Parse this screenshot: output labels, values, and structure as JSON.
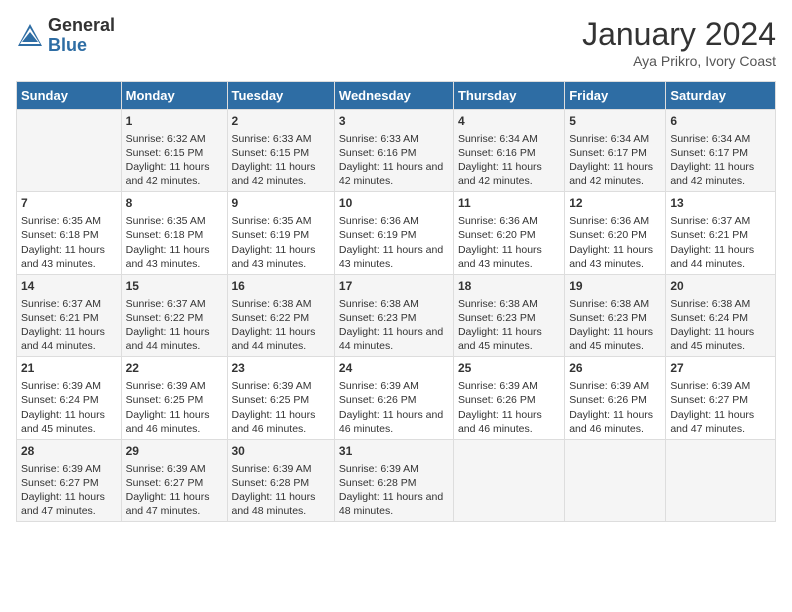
{
  "header": {
    "logo_general": "General",
    "logo_blue": "Blue",
    "month_title": "January 2024",
    "subtitle": "Aya Prikro, Ivory Coast"
  },
  "days_of_week": [
    "Sunday",
    "Monday",
    "Tuesday",
    "Wednesday",
    "Thursday",
    "Friday",
    "Saturday"
  ],
  "weeks": [
    [
      {
        "day": "",
        "sunrise": "",
        "sunset": "",
        "daylight": ""
      },
      {
        "day": "1",
        "sunrise": "Sunrise: 6:32 AM",
        "sunset": "Sunset: 6:15 PM",
        "daylight": "Daylight: 11 hours and 42 minutes."
      },
      {
        "day": "2",
        "sunrise": "Sunrise: 6:33 AM",
        "sunset": "Sunset: 6:15 PM",
        "daylight": "Daylight: 11 hours and 42 minutes."
      },
      {
        "day": "3",
        "sunrise": "Sunrise: 6:33 AM",
        "sunset": "Sunset: 6:16 PM",
        "daylight": "Daylight: 11 hours and 42 minutes."
      },
      {
        "day": "4",
        "sunrise": "Sunrise: 6:34 AM",
        "sunset": "Sunset: 6:16 PM",
        "daylight": "Daylight: 11 hours and 42 minutes."
      },
      {
        "day": "5",
        "sunrise": "Sunrise: 6:34 AM",
        "sunset": "Sunset: 6:17 PM",
        "daylight": "Daylight: 11 hours and 42 minutes."
      },
      {
        "day": "6",
        "sunrise": "Sunrise: 6:34 AM",
        "sunset": "Sunset: 6:17 PM",
        "daylight": "Daylight: 11 hours and 42 minutes."
      }
    ],
    [
      {
        "day": "7",
        "sunrise": "Sunrise: 6:35 AM",
        "sunset": "Sunset: 6:18 PM",
        "daylight": "Daylight: 11 hours and 43 minutes."
      },
      {
        "day": "8",
        "sunrise": "Sunrise: 6:35 AM",
        "sunset": "Sunset: 6:18 PM",
        "daylight": "Daylight: 11 hours and 43 minutes."
      },
      {
        "day": "9",
        "sunrise": "Sunrise: 6:35 AM",
        "sunset": "Sunset: 6:19 PM",
        "daylight": "Daylight: 11 hours and 43 minutes."
      },
      {
        "day": "10",
        "sunrise": "Sunrise: 6:36 AM",
        "sunset": "Sunset: 6:19 PM",
        "daylight": "Daylight: 11 hours and 43 minutes."
      },
      {
        "day": "11",
        "sunrise": "Sunrise: 6:36 AM",
        "sunset": "Sunset: 6:20 PM",
        "daylight": "Daylight: 11 hours and 43 minutes."
      },
      {
        "day": "12",
        "sunrise": "Sunrise: 6:36 AM",
        "sunset": "Sunset: 6:20 PM",
        "daylight": "Daylight: 11 hours and 43 minutes."
      },
      {
        "day": "13",
        "sunrise": "Sunrise: 6:37 AM",
        "sunset": "Sunset: 6:21 PM",
        "daylight": "Daylight: 11 hours and 44 minutes."
      }
    ],
    [
      {
        "day": "14",
        "sunrise": "Sunrise: 6:37 AM",
        "sunset": "Sunset: 6:21 PM",
        "daylight": "Daylight: 11 hours and 44 minutes."
      },
      {
        "day": "15",
        "sunrise": "Sunrise: 6:37 AM",
        "sunset": "Sunset: 6:22 PM",
        "daylight": "Daylight: 11 hours and 44 minutes."
      },
      {
        "day": "16",
        "sunrise": "Sunrise: 6:38 AM",
        "sunset": "Sunset: 6:22 PM",
        "daylight": "Daylight: 11 hours and 44 minutes."
      },
      {
        "day": "17",
        "sunrise": "Sunrise: 6:38 AM",
        "sunset": "Sunset: 6:23 PM",
        "daylight": "Daylight: 11 hours and 44 minutes."
      },
      {
        "day": "18",
        "sunrise": "Sunrise: 6:38 AM",
        "sunset": "Sunset: 6:23 PM",
        "daylight": "Daylight: 11 hours and 45 minutes."
      },
      {
        "day": "19",
        "sunrise": "Sunrise: 6:38 AM",
        "sunset": "Sunset: 6:23 PM",
        "daylight": "Daylight: 11 hours and 45 minutes."
      },
      {
        "day": "20",
        "sunrise": "Sunrise: 6:38 AM",
        "sunset": "Sunset: 6:24 PM",
        "daylight": "Daylight: 11 hours and 45 minutes."
      }
    ],
    [
      {
        "day": "21",
        "sunrise": "Sunrise: 6:39 AM",
        "sunset": "Sunset: 6:24 PM",
        "daylight": "Daylight: 11 hours and 45 minutes."
      },
      {
        "day": "22",
        "sunrise": "Sunrise: 6:39 AM",
        "sunset": "Sunset: 6:25 PM",
        "daylight": "Daylight: 11 hours and 46 minutes."
      },
      {
        "day": "23",
        "sunrise": "Sunrise: 6:39 AM",
        "sunset": "Sunset: 6:25 PM",
        "daylight": "Daylight: 11 hours and 46 minutes."
      },
      {
        "day": "24",
        "sunrise": "Sunrise: 6:39 AM",
        "sunset": "Sunset: 6:26 PM",
        "daylight": "Daylight: 11 hours and 46 minutes."
      },
      {
        "day": "25",
        "sunrise": "Sunrise: 6:39 AM",
        "sunset": "Sunset: 6:26 PM",
        "daylight": "Daylight: 11 hours and 46 minutes."
      },
      {
        "day": "26",
        "sunrise": "Sunrise: 6:39 AM",
        "sunset": "Sunset: 6:26 PM",
        "daylight": "Daylight: 11 hours and 46 minutes."
      },
      {
        "day": "27",
        "sunrise": "Sunrise: 6:39 AM",
        "sunset": "Sunset: 6:27 PM",
        "daylight": "Daylight: 11 hours and 47 minutes."
      }
    ],
    [
      {
        "day": "28",
        "sunrise": "Sunrise: 6:39 AM",
        "sunset": "Sunset: 6:27 PM",
        "daylight": "Daylight: 11 hours and 47 minutes."
      },
      {
        "day": "29",
        "sunrise": "Sunrise: 6:39 AM",
        "sunset": "Sunset: 6:27 PM",
        "daylight": "Daylight: 11 hours and 47 minutes."
      },
      {
        "day": "30",
        "sunrise": "Sunrise: 6:39 AM",
        "sunset": "Sunset: 6:28 PM",
        "daylight": "Daylight: 11 hours and 48 minutes."
      },
      {
        "day": "31",
        "sunrise": "Sunrise: 6:39 AM",
        "sunset": "Sunset: 6:28 PM",
        "daylight": "Daylight: 11 hours and 48 minutes."
      },
      {
        "day": "",
        "sunrise": "",
        "sunset": "",
        "daylight": ""
      },
      {
        "day": "",
        "sunrise": "",
        "sunset": "",
        "daylight": ""
      },
      {
        "day": "",
        "sunrise": "",
        "sunset": "",
        "daylight": ""
      }
    ]
  ]
}
